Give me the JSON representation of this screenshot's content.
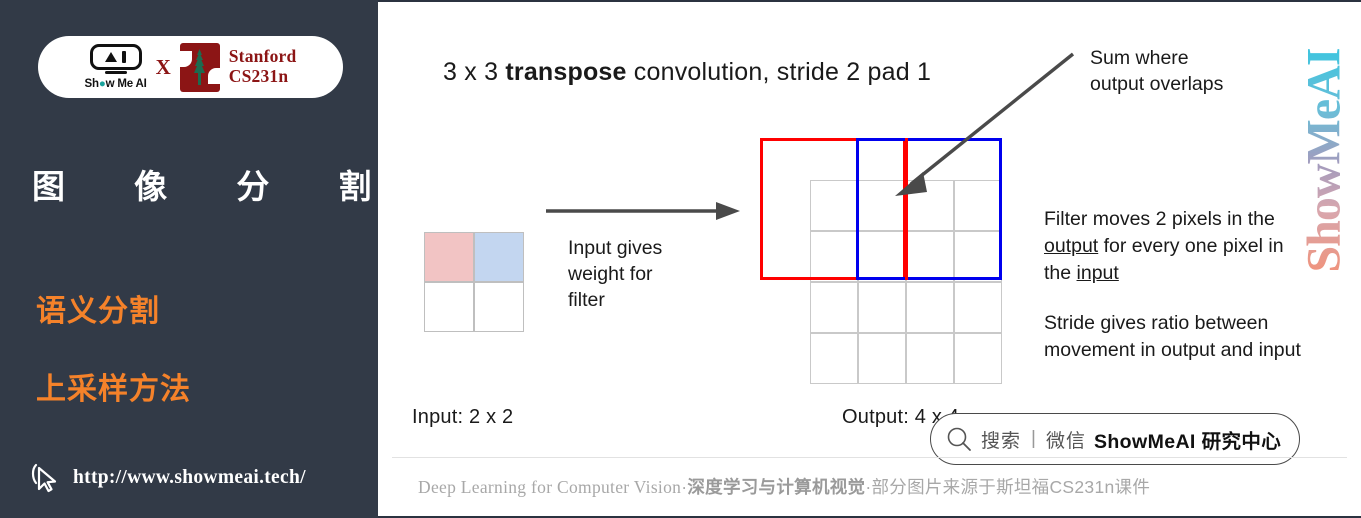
{
  "sidebar": {
    "badge": {
      "brand_name": "Show Me AI",
      "cross": "X",
      "partner_line1": "Stanford",
      "partner_line2": "CS231n"
    },
    "title": "图 像 分 割",
    "headings": [
      "语义分割",
      "上采样方法"
    ],
    "url": "http://www.showmeai.tech/",
    "cursor_icon": "cursor-pointer-icon",
    "colors": {
      "background": "#323a47",
      "accent_orange": "#F5822A",
      "title_white": "#ffffff",
      "stanford_red": "#8C1515"
    }
  },
  "main": {
    "slide_title": {
      "pre": "3 x 3 ",
      "bold": "transpose",
      "post": " convolution, stride 2 pad 1"
    },
    "input": {
      "label": "Input: 2 x 2",
      "cells": [
        "pink",
        "blue",
        "white",
        "white"
      ],
      "cell_colors": {
        "pink": "#f2c4c4",
        "blue": "#c3d6f0",
        "white": "#ffffff"
      }
    },
    "arrow_caption": "Input gives\nweight for\nfilter",
    "arrow_caption_lines": [
      "Input gives",
      "weight for",
      "filter"
    ],
    "output": {
      "label": "Output: 4 x 4",
      "grid_rows": 4,
      "grid_cols": 4,
      "red_box_color": "#ff0000",
      "blue_box_color": "#0000ee",
      "grid_line_color": "#c9c9c9"
    },
    "notes": {
      "sum_lines": [
        "Sum where",
        "output overlaps"
      ],
      "filter_pre": "Filter moves 2 pixels in the ",
      "filter_u1": "output",
      "filter_mid": " for every one pixel in the ",
      "filter_u2": "input",
      "stride": "Stride gives ratio between movement in output and input"
    },
    "watermark": "ShowMeAI",
    "wechat_badge": {
      "search_icon": "magnifier-icon",
      "action": "搜索",
      "separator": "|",
      "platform": "微信",
      "account": "ShowMeAI 研究中心"
    },
    "footer": {
      "en": "Deep Learning for Computer Vision",
      "dot1": "·",
      "cn_bold": "深度学习与计算机视觉",
      "dot2": "·",
      "cn_tail": "部分图片来源于斯坦福CS231n课件"
    }
  }
}
